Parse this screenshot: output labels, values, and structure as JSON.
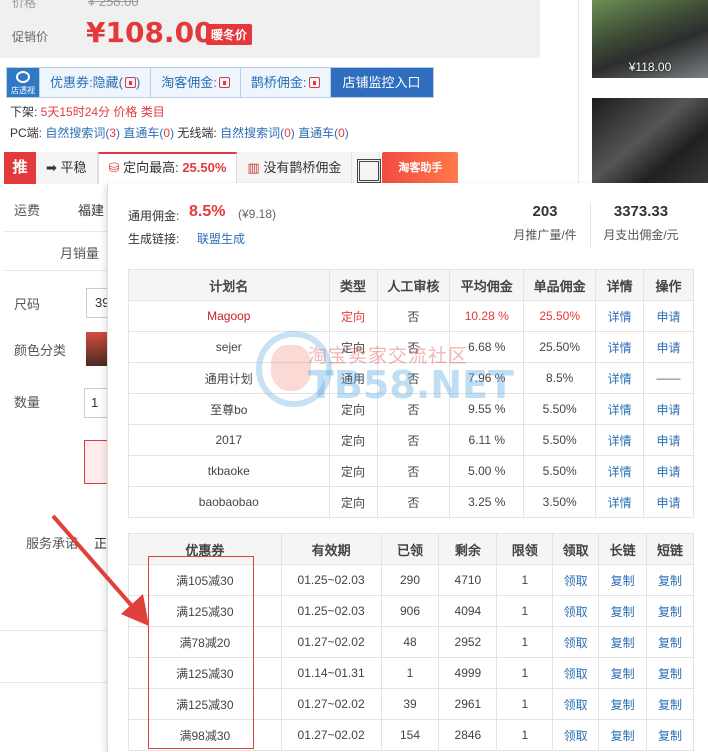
{
  "price": {
    "orig_label": "价格",
    "orig_price": "¥ 258.00",
    "promo_label": "促销价",
    "promo_price": "¥108.00",
    "promo_badge": "暖冬价",
    "color_accent": "#e4393c"
  },
  "thumbs": {
    "thumb1_price": "¥118.00"
  },
  "tools": {
    "logo_text": "店透视",
    "coupon": "优惠券:隐藏(",
    "coupon_end": ")",
    "taoke": "淘客佣金:",
    "queqiao": "鹊桥佣金:",
    "monitor": "店铺监控入口"
  },
  "info": {
    "shelf_label": "下架: ",
    "shelf_value": "5天15时24分",
    "price_label": " 价格 ",
    "price_value": "类目",
    "pc_label": "PC端: ",
    "pc_search": "自然搜索词(",
    "pc_search_n": "3",
    "pc_search_end": ")",
    "pc_direct": "直通车(",
    "pc_direct_n": "0",
    "pc_direct_end": ")",
    "wireless_label": " 无线端: ",
    "w_search": "自然搜索词(",
    "w_search_n": "0",
    "w_search_end": ")",
    "w_direct": "直通车(",
    "w_direct_n": "0",
    "w_direct_end": ")"
  },
  "tabs": {
    "push": "推",
    "stable": "平稳",
    "targeted_label": "定向最高: ",
    "targeted_pct": "25.50%",
    "no_queqiao": "没有鹊桥佣金",
    "helper": "淘客助手"
  },
  "bg": {
    "shipping": "运费",
    "shipping_val": "福建",
    "monthly_sales": "月销量",
    "size": "尺码",
    "size_val": "39",
    "color": "颜色分类",
    "qty": "数量",
    "qty_val": "1",
    "service": "服务承诺",
    "service_val": "正"
  },
  "panel": {
    "rate_label": "通用佣金: ",
    "rate_value": "8.5%",
    "rate_sub": "(¥9.18)",
    "gen_label": "生成链接: ",
    "gen_link": "联盟生成",
    "stats": [
      {
        "num": "203",
        "label": "月推广量/件"
      },
      {
        "num": "3373.33",
        "label": "月支出佣金/元"
      }
    ]
  },
  "plans": {
    "headers": [
      "计划名",
      "类型",
      "人工审核",
      "平均佣金",
      "单品佣金",
      "详情",
      "操作"
    ],
    "rows": [
      {
        "name": "Magoop",
        "type": "定向",
        "review": "否",
        "avg": "10.28 %",
        "single": "25.50%",
        "detail": "详情",
        "action": "申请"
      },
      {
        "name": "sejer",
        "type": "定向",
        "review": "否",
        "avg": "6.68 %",
        "single": "25.50%",
        "detail": "详情",
        "action": "申请"
      },
      {
        "name": "通用计划",
        "type": "通用",
        "review": "否",
        "avg": "7.96 %",
        "single": "8.5%",
        "detail": "详情",
        "action": "——"
      },
      {
        "name": "至尊bo",
        "type": "定向",
        "review": "否",
        "avg": "9.55 %",
        "single": "5.50%",
        "detail": "详情",
        "action": "申请"
      },
      {
        "name": "2017",
        "type": "定向",
        "review": "否",
        "avg": "6.11 %",
        "single": "5.50%",
        "detail": "详情",
        "action": "申请"
      },
      {
        "name": "tkbaoke",
        "type": "定向",
        "review": "否",
        "avg": "5.00 %",
        "single": "5.50%",
        "detail": "详情",
        "action": "申请"
      },
      {
        "name": "baobaobao",
        "type": "定向",
        "review": "否",
        "avg": "3.25 %",
        "single": "3.50%",
        "detail": "详情",
        "action": "申请"
      }
    ]
  },
  "coupons": {
    "headers": [
      "优惠券",
      "有效期",
      "已领",
      "剩余",
      "限领",
      "领取",
      "长链",
      "短链"
    ],
    "rows": [
      {
        "name": "满105减30",
        "period": "01.25~02.03",
        "taken": "290",
        "left": "4710",
        "limit": "1",
        "get": "领取",
        "long": "复制",
        "short": "复制"
      },
      {
        "name": "满125减30",
        "period": "01.25~02.03",
        "taken": "906",
        "left": "4094",
        "limit": "1",
        "get": "领取",
        "long": "复制",
        "short": "复制"
      },
      {
        "name": "满78减20",
        "period": "01.27~02.02",
        "taken": "48",
        "left": "2952",
        "limit": "1",
        "get": "领取",
        "long": "复制",
        "short": "复制"
      },
      {
        "name": "满125减30",
        "period": "01.14~01.31",
        "taken": "1",
        "left": "4999",
        "limit": "1",
        "get": "领取",
        "long": "复制",
        "short": "复制"
      },
      {
        "name": "满125减30",
        "period": "01.27~02.02",
        "taken": "39",
        "left": "2961",
        "limit": "1",
        "get": "领取",
        "long": "复制",
        "short": "复制"
      },
      {
        "name": "满98减30",
        "period": "01.27~02.02",
        "taken": "154",
        "left": "2846",
        "limit": "1",
        "get": "领取",
        "long": "复制",
        "short": "复制"
      }
    ]
  },
  "watermark": {
    "cn": "淘宝卖家交流社区",
    "en": "TB58.NET"
  }
}
